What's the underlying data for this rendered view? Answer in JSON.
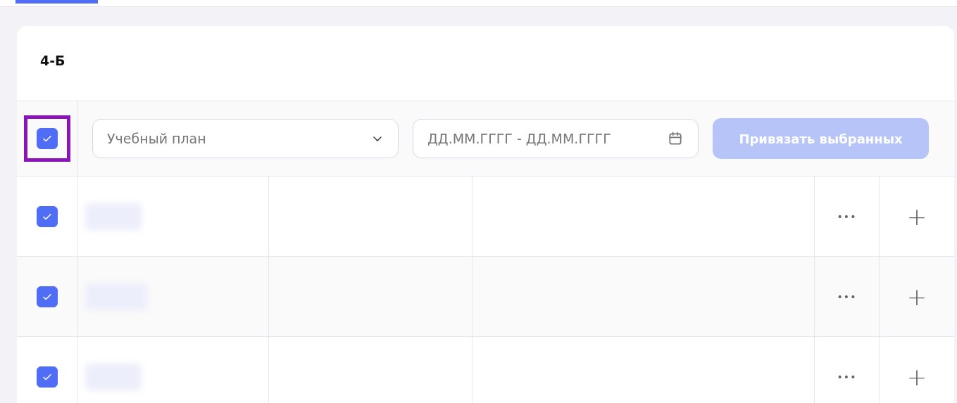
{
  "tabs": [
    {
      "selected": true
    }
  ],
  "card": {
    "title": "4-Б"
  },
  "toolbar": {
    "select_all": {
      "checked": true,
      "highlighted": true
    },
    "plan_select": {
      "placeholder": "Учебный план"
    },
    "date_range": {
      "placeholder": "ДД.ММ.ГГГГ - ДД.ММ.ГГГГ"
    },
    "bind_button": {
      "label": "Привязать выбранных",
      "disabled": true
    }
  },
  "rows": [
    {
      "checked": true,
      "more": "•••",
      "add": "+"
    },
    {
      "checked": true,
      "more": "•••",
      "add": "+"
    },
    {
      "checked": true,
      "more": "•••",
      "add": "+"
    }
  ]
}
